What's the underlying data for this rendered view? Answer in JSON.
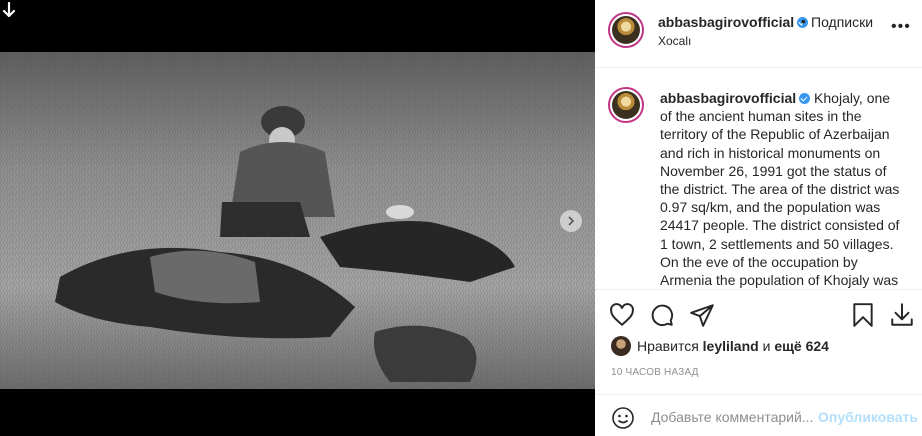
{
  "header": {
    "username": "abbasbagirovofficial",
    "separator": "•",
    "follow_label": "Подписки",
    "location": "Xocalı",
    "more_icon": "more-horizontal-icon"
  },
  "caption": {
    "username": "abbasbagirovofficial",
    "text": "Khojaly, one of the ancient human sites in the territory of the Republic of Azerbaijan and rich in historical monuments on November 26, 1991 got the status of the district. The area of the district was 0.97 sq/km, and the population was 24417 people. The district consisted of 1 town, 2 settlements and 50 villages. On the eve of the occupation by Armenia the population of Khojaly was"
  },
  "likes": {
    "prefix": "Нравится",
    "user": "leyliland",
    "middle": "и",
    "others": "ещё 624"
  },
  "time_ago": "10 ЧАСОВ НАЗАД",
  "comment_box": {
    "placeholder": "Добавьте комментарий...",
    "publish_label": "Опубликовать"
  },
  "colors": {
    "accent": "#3897f0",
    "publish_disabled": "#b2dffc",
    "muted": "#8e8e8e",
    "text": "#262626"
  },
  "icons": [
    "download-icon",
    "next-arrow-icon",
    "heart-icon",
    "comment-icon",
    "share-icon",
    "bookmark-icon",
    "download-icon",
    "emoji-icon"
  ]
}
